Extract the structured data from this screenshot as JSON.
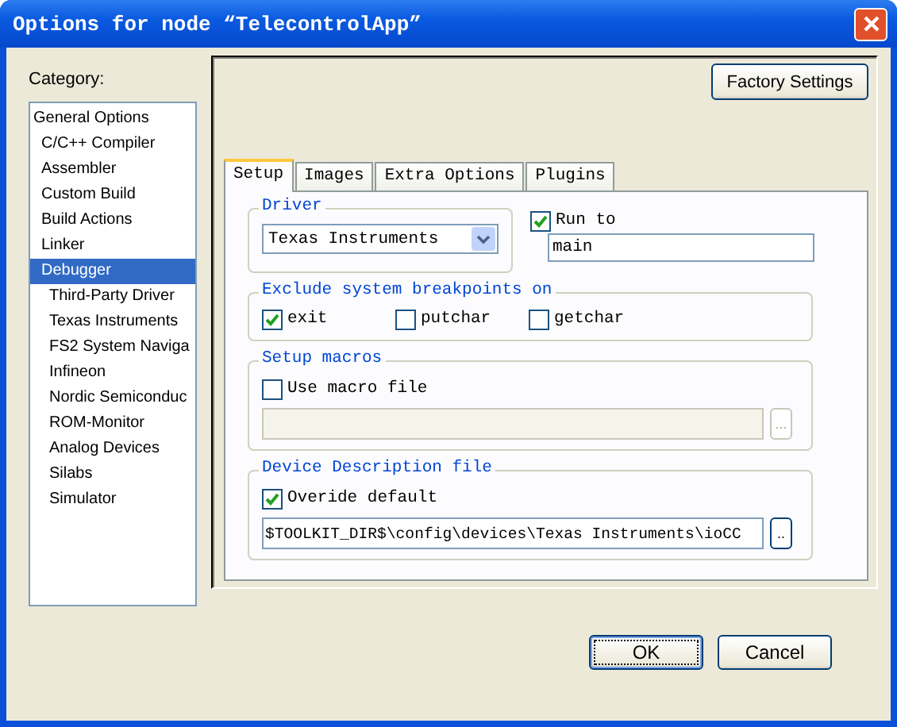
{
  "window": {
    "title": "Options for node “TelecontrolApp”"
  },
  "category": {
    "label": "Category:",
    "items": [
      {
        "label": "General Options",
        "selected": false,
        "children": [
          {
            "label": "C/C++ Compiler",
            "selected": false
          },
          {
            "label": "Assembler",
            "selected": false
          },
          {
            "label": "Custom Build",
            "selected": false
          },
          {
            "label": "Build Actions",
            "selected": false
          },
          {
            "label": "Linker",
            "selected": false
          },
          {
            "label": "Debugger",
            "selected": true,
            "children": [
              {
                "label": "Third-Party Driver",
                "selected": false
              },
              {
                "label": "Texas Instruments",
                "selected": false
              },
              {
                "label": "FS2 System Naviga",
                "selected": false
              },
              {
                "label": "Infineon",
                "selected": false
              },
              {
                "label": "Nordic Semiconduc",
                "selected": false
              },
              {
                "label": "ROM-Monitor",
                "selected": false
              },
              {
                "label": "Analog Devices",
                "selected": false
              },
              {
                "label": "Silabs",
                "selected": false
              },
              {
                "label": "Simulator",
                "selected": false
              }
            ]
          }
        ]
      }
    ]
  },
  "factory_button": "Factory Settings",
  "tabs": [
    {
      "label": "Setup",
      "selected": true
    },
    {
      "label": "Images",
      "selected": false
    },
    {
      "label": "Extra Options",
      "selected": false
    },
    {
      "label": "Plugins",
      "selected": false
    }
  ],
  "driver": {
    "legend": "Driver",
    "value": "Texas Instruments"
  },
  "run_to": {
    "label": "Run to",
    "checked": true,
    "value": "main"
  },
  "exclude": {
    "legend": "Exclude system breakpoints on",
    "options": [
      {
        "label": "exit",
        "checked": true
      },
      {
        "label": "putchar",
        "checked": false
      },
      {
        "label": "getchar",
        "checked": false
      }
    ]
  },
  "macros": {
    "legend": "Setup macros",
    "checkbox": {
      "label": "Use macro file",
      "checked": false
    },
    "browse": "...",
    "disabled": true
  },
  "device": {
    "legend": "Device Description file",
    "checkbox": {
      "label": "Overide default",
      "checked": true
    },
    "value": "$TOOLKIT_DIR$\\config\\devices\\Texas Instruments\\ioCC",
    "browse": "..",
    "disabled": false
  },
  "buttons": [
    {
      "label": "OK",
      "default": true
    },
    {
      "label": "Cancel",
      "default": false
    }
  ]
}
